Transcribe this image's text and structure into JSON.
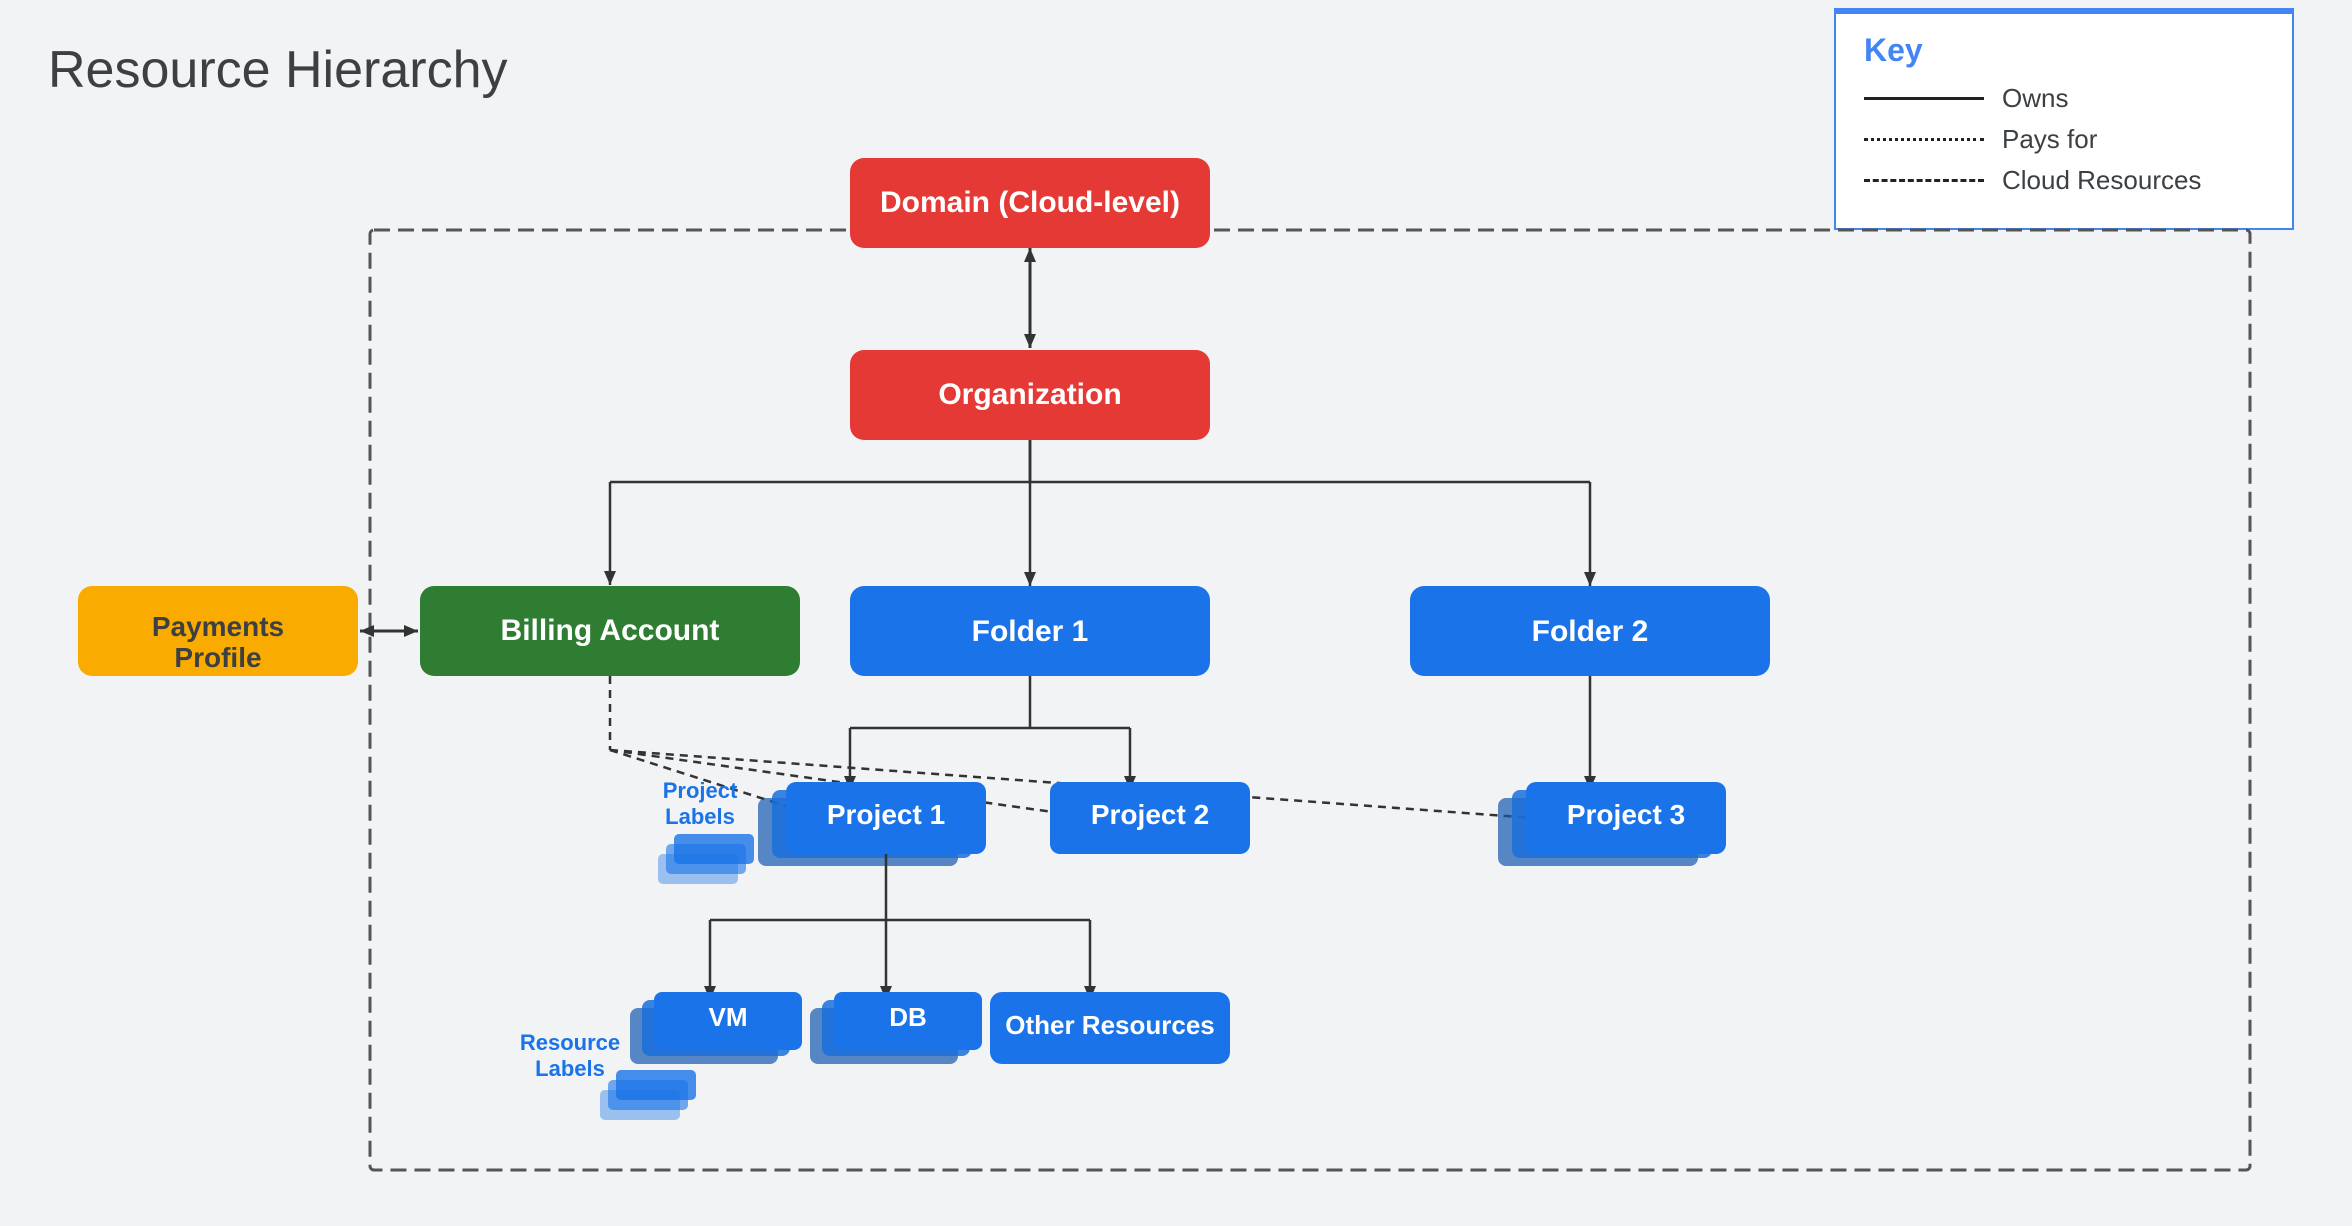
{
  "page": {
    "title": "Resource Hierarchy",
    "background": "#f1f3f4"
  },
  "key": {
    "title": "Key",
    "items": [
      {
        "line": "solid",
        "label": "Owns"
      },
      {
        "line": "dotted",
        "label": "Pays for"
      },
      {
        "line": "dashed",
        "label": "Cloud Resources"
      }
    ]
  },
  "nodes": {
    "domain": "Domain (Cloud-level)",
    "organization": "Organization",
    "billing_account": "Billing Account",
    "payments_profile": "Payments Profile",
    "folder1": "Folder 1",
    "folder2": "Folder 2",
    "project1": "Project 1",
    "project2": "Project 2",
    "project3": "Project 3",
    "project_labels": "Project Labels",
    "resource_labels": "Resource Labels",
    "vm": "VM",
    "db": "DB",
    "other_resources": "Other Resources"
  }
}
